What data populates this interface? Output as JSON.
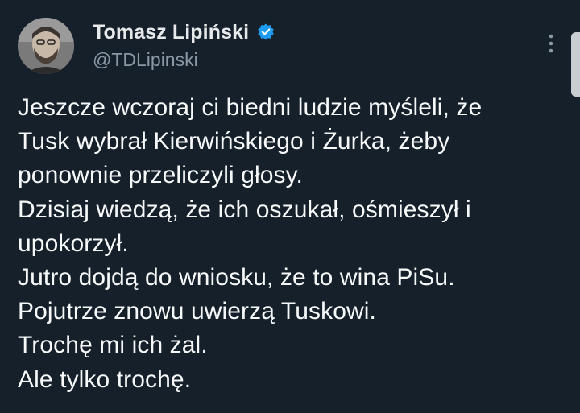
{
  "author": {
    "display_name": "Tomasz Lipiński",
    "handle": "@TDLipinski",
    "verified": true,
    "verified_color": "#1d9bf0"
  },
  "tweet": {
    "lines": [
      "Jeszcze wczoraj ci biedni ludzie myśleli, że",
      "Tusk wybrał Kierwińskiego i Żurka, żeby",
      "ponownie przeliczyli głosy.",
      "Dzisiaj wiedzą, że ich oszukał, ośmieszył i",
      "upokorzył.",
      "Jutro dojdą do wniosku, że to wina PiSu.",
      "Pojutrze znowu uwierzą Tuskowi.",
      "Trochę mi ich żal.",
      "Ale tylko trochę."
    ]
  },
  "icons": {
    "verified": "verified-badge-icon",
    "more": "more-options-icon"
  },
  "colors": {
    "background": "#15202b",
    "text": "#f7f9f9",
    "secondary_text": "#8b98a5"
  }
}
